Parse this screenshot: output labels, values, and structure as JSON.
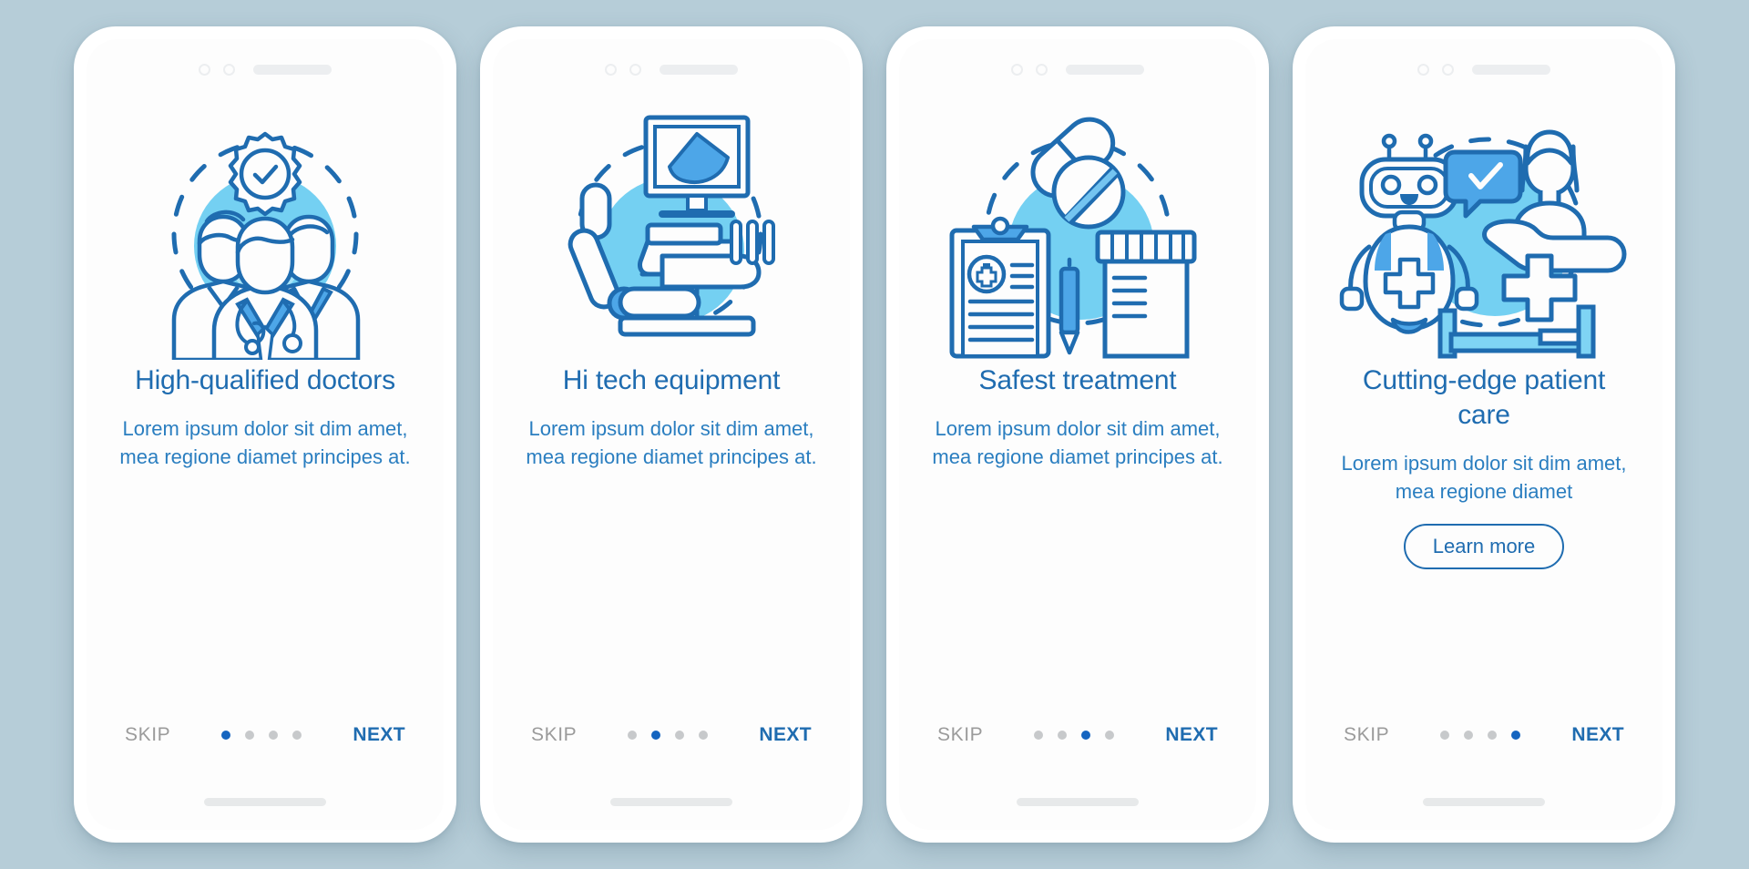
{
  "page": {
    "background_color": "#b6cdd8",
    "accent_color": "#1f6cb0",
    "accent_light": "#5bc3ee",
    "accent_mid": "#4da6e8",
    "muted_color": "#9b9b9b",
    "dot_active_color": "#1565c0",
    "dot_inactive_color": "#c7c9cb"
  },
  "nav": {
    "skip_label": "SKIP",
    "next_label": "NEXT",
    "dot_count": 4
  },
  "screens": [
    {
      "id": "high-qualified-doctors",
      "illustration": "doctors-team-badge-illustration",
      "title": "High-qualified doctors",
      "description": "Lorem ipsum dolor sit dim amet, mea regione diamet principes at.",
      "active_dot": 1,
      "has_learn_more": false,
      "learn_more_label": ""
    },
    {
      "id": "hi-tech-equipment",
      "illustration": "medical-scanner-chair-illustration",
      "title": "Hi tech equipment",
      "description": "Lorem ipsum dolor sit dim amet, mea regione diamet principes at.",
      "active_dot": 2,
      "has_learn_more": false,
      "learn_more_label": ""
    },
    {
      "id": "safest-treatment",
      "illustration": "pills-clipboard-prescription-illustration",
      "title": "Safest treatment",
      "description": "Lorem ipsum dolor sit dim amet, mea regione diamet principes at.",
      "active_dot": 3,
      "has_learn_more": false,
      "learn_more_label": ""
    },
    {
      "id": "cutting-edge-patient-care",
      "illustration": "robot-nurse-care-illustration",
      "title": "Cutting-edge patient care",
      "description": "Lorem ipsum dolor sit dim amet, mea regione diamet",
      "active_dot": 4,
      "has_learn_more": true,
      "learn_more_label": "Learn more"
    }
  ]
}
